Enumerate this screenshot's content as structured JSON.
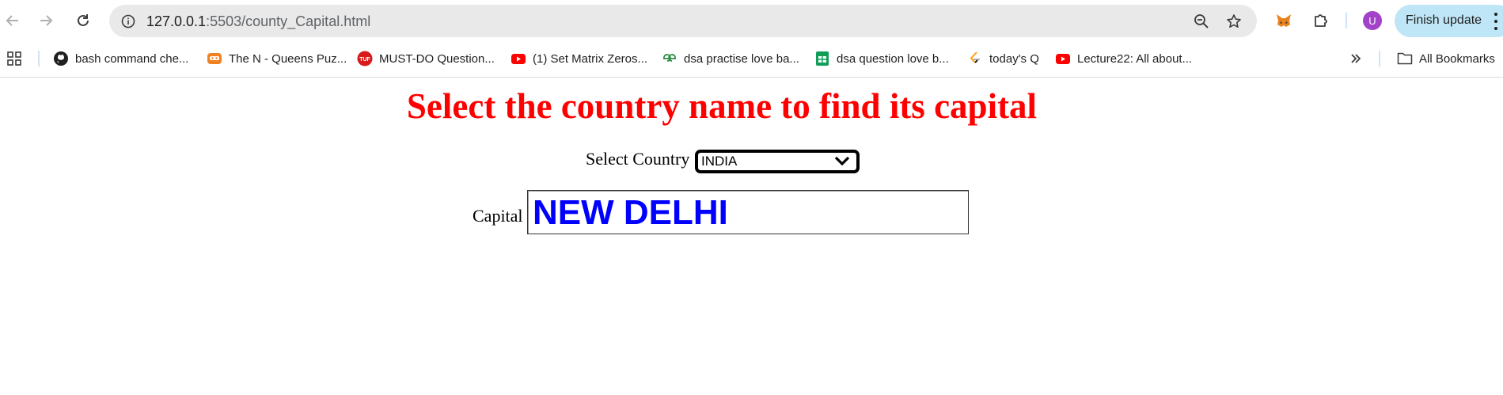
{
  "browser": {
    "url": {
      "host": "127.0.0.1",
      "path": ":5503/county_Capital.html"
    },
    "profile_initial": "U",
    "update_button_label": "Finish update",
    "bookmarks": [
      {
        "label": "bash command che...",
        "icon": "github-icon"
      },
      {
        "label": "The N - Queens Puz...",
        "icon": "codingninjas-icon"
      },
      {
        "label": "MUST-DO Question...",
        "icon": "tuf-icon"
      },
      {
        "label": "(1) Set Matrix Zeros...",
        "icon": "youtube-icon"
      },
      {
        "label": "dsa practise love ba...",
        "icon": "geeksforgeeks-icon"
      },
      {
        "label": "dsa question love b...",
        "icon": "google-sheets-icon"
      },
      {
        "label": "today's Q",
        "icon": "leetcode-icon"
      },
      {
        "label": "Lecture22: All about...",
        "icon": "youtube-icon"
      }
    ],
    "all_bookmarks_label": "All Bookmarks"
  },
  "page": {
    "title": "Select the country name to find its capital",
    "country_label": "Select Country",
    "country_selected": "INDIA",
    "capital_label": "Capital",
    "capital_value": "NEW DELHI"
  },
  "colors": {
    "title": "#ff0000",
    "capital_value": "#0000ff",
    "omnibox_bg": "#e9e9e9",
    "update_button_bg": "#bfe6f6",
    "avatar_bg": "#a142c9"
  }
}
